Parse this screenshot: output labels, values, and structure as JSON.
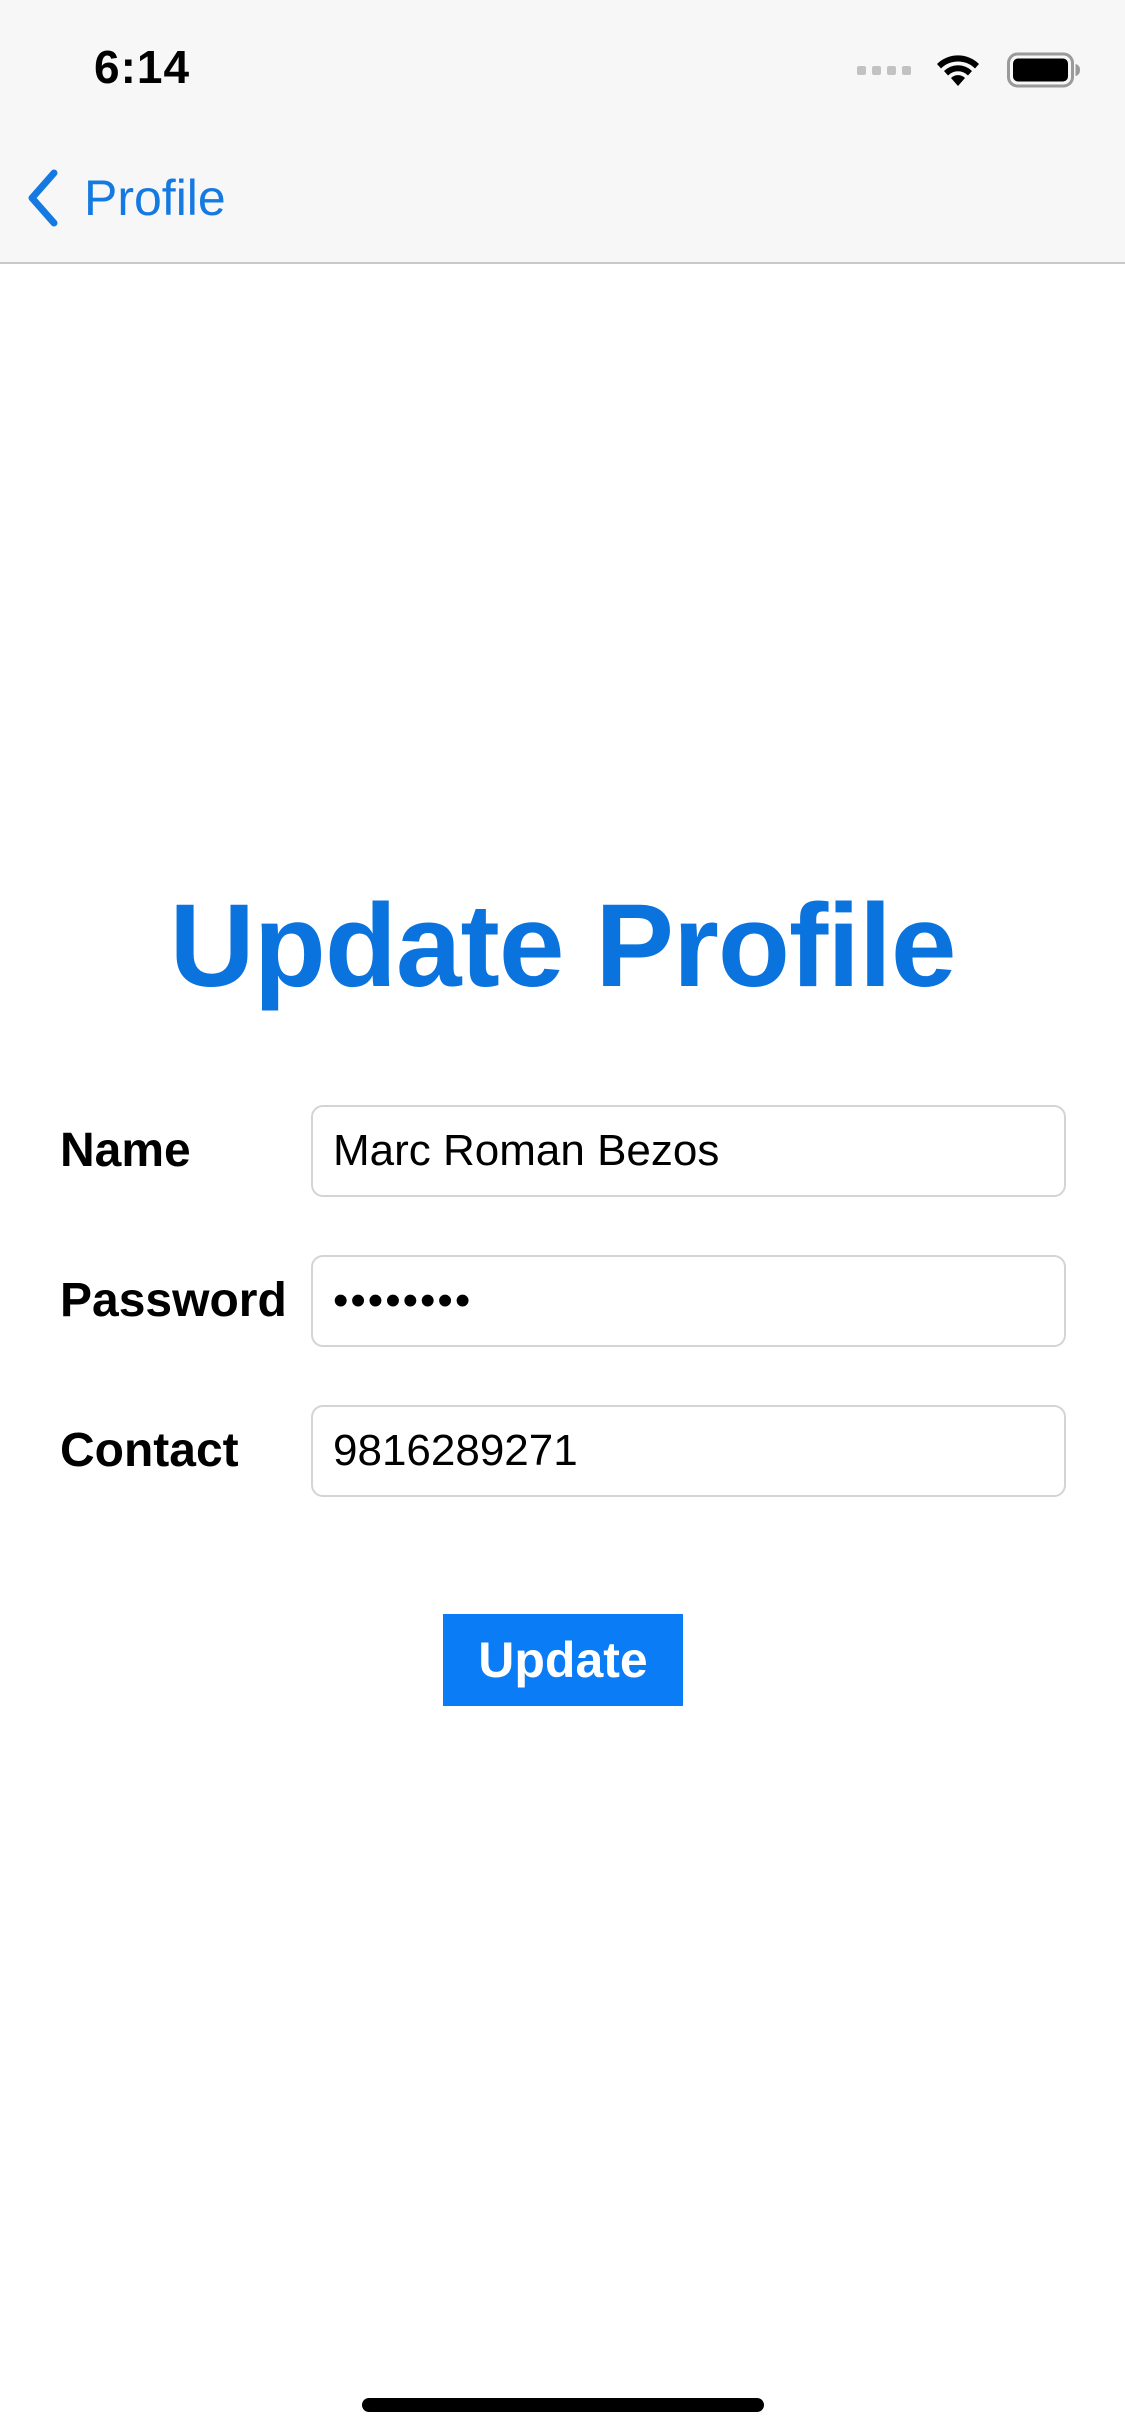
{
  "status_bar": {
    "time": "6:14",
    "icons": [
      "signal-icon",
      "wifi-icon",
      "battery-icon"
    ]
  },
  "nav": {
    "back_label": "Profile",
    "back_icon": "chevron-left-icon"
  },
  "page": {
    "title": "Update Profile"
  },
  "form": {
    "name_label": "Name",
    "name_value": "Marc Roman Bezos",
    "password_label": "Password",
    "password_value": "••••••••",
    "contact_label": "Contact",
    "contact_value": "9816289271"
  },
  "actions": {
    "update_label": "Update"
  },
  "colors": {
    "accent": "#0a7cf6",
    "title": "#0b73dd",
    "nav_background": "#f7f7f7",
    "field_border": "#d4d4d6"
  }
}
